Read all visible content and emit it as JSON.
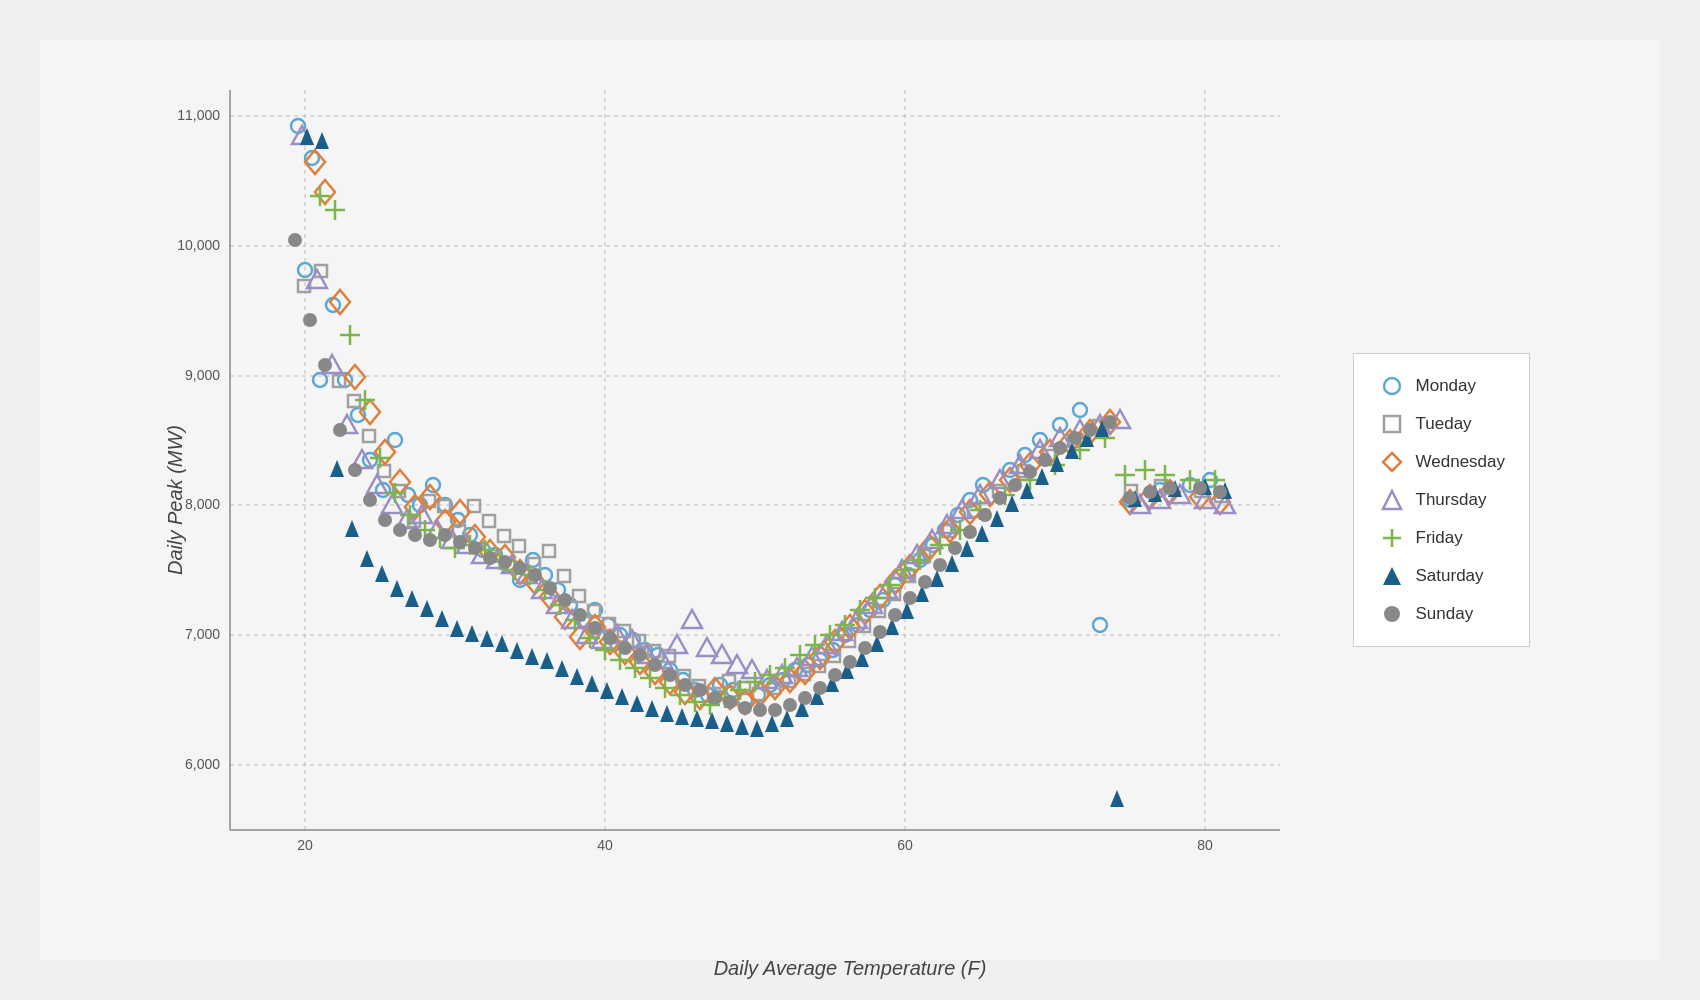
{
  "chart": {
    "title": "",
    "x_axis_label": "Daily Average Temperature (F)",
    "y_axis_label": "Daily Peak (MW)",
    "x_min": 15,
    "x_max": 85,
    "y_min": 5500,
    "y_max": 11200,
    "y_ticks": [
      6000,
      7000,
      8000,
      9000,
      10000,
      11000
    ],
    "x_ticks": [
      20,
      40,
      60,
      80
    ]
  },
  "legend": {
    "items": [
      {
        "label": "Monday",
        "shape": "circle",
        "color": "#5ba8d4"
      },
      {
        "label": "Tueday",
        "shape": "square",
        "color": "#a0a0a0"
      },
      {
        "label": "Wednesday",
        "shape": "diamond",
        "color": "#e07f3a"
      },
      {
        "label": "Thursday",
        "shape": "triangle",
        "color": "#9b8ec4"
      },
      {
        "label": "Friday",
        "shape": "plus",
        "color": "#7ab648"
      },
      {
        "label": "Saturday",
        "shape": "arrow-up",
        "color": "#1a5f8a"
      },
      {
        "label": "Sunday",
        "shape": "circle-filled",
        "color": "#888"
      }
    ]
  }
}
